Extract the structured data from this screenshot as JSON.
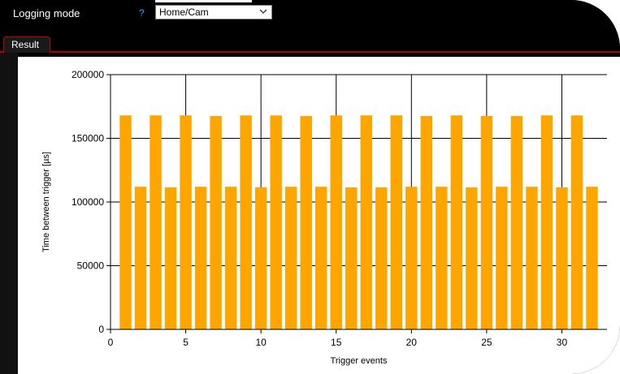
{
  "top": {
    "logging_mode_label": "Logging mode",
    "help_icon_glyph": "?",
    "logging_mode_value": "Home/Cam"
  },
  "tabs": [
    {
      "label": "Result"
    }
  ],
  "colors": {
    "bar": "#FFA500",
    "accent_border": "#C00000",
    "help": "#2EA3FF"
  },
  "chart_data": {
    "type": "bar",
    "xlabel": "Trigger events",
    "ylabel": "Time between trigger [µs]",
    "xlim": [
      0,
      33
    ],
    "ylim": [
      0,
      200000
    ],
    "xticks": [
      0,
      5,
      10,
      15,
      20,
      25,
      30
    ],
    "yticks": [
      0,
      50000,
      100000,
      150000,
      200000
    ],
    "grid": true,
    "x": [
      1,
      2,
      3,
      4,
      5,
      6,
      7,
      8,
      9,
      10,
      11,
      12,
      13,
      14,
      15,
      16,
      17,
      18,
      19,
      20,
      21,
      22,
      23,
      24,
      25,
      26,
      27,
      28,
      29,
      30,
      31,
      32
    ],
    "values": [
      168000,
      112000,
      168000,
      111500,
      168000,
      112000,
      167500,
      112000,
      168000,
      111500,
      168000,
      112000,
      167500,
      112000,
      168000,
      111500,
      168000,
      111500,
      168000,
      112000,
      167500,
      112000,
      168000,
      111500,
      167500,
      112000,
      167500,
      112000,
      168000,
      111500,
      168000,
      112000
    ]
  }
}
